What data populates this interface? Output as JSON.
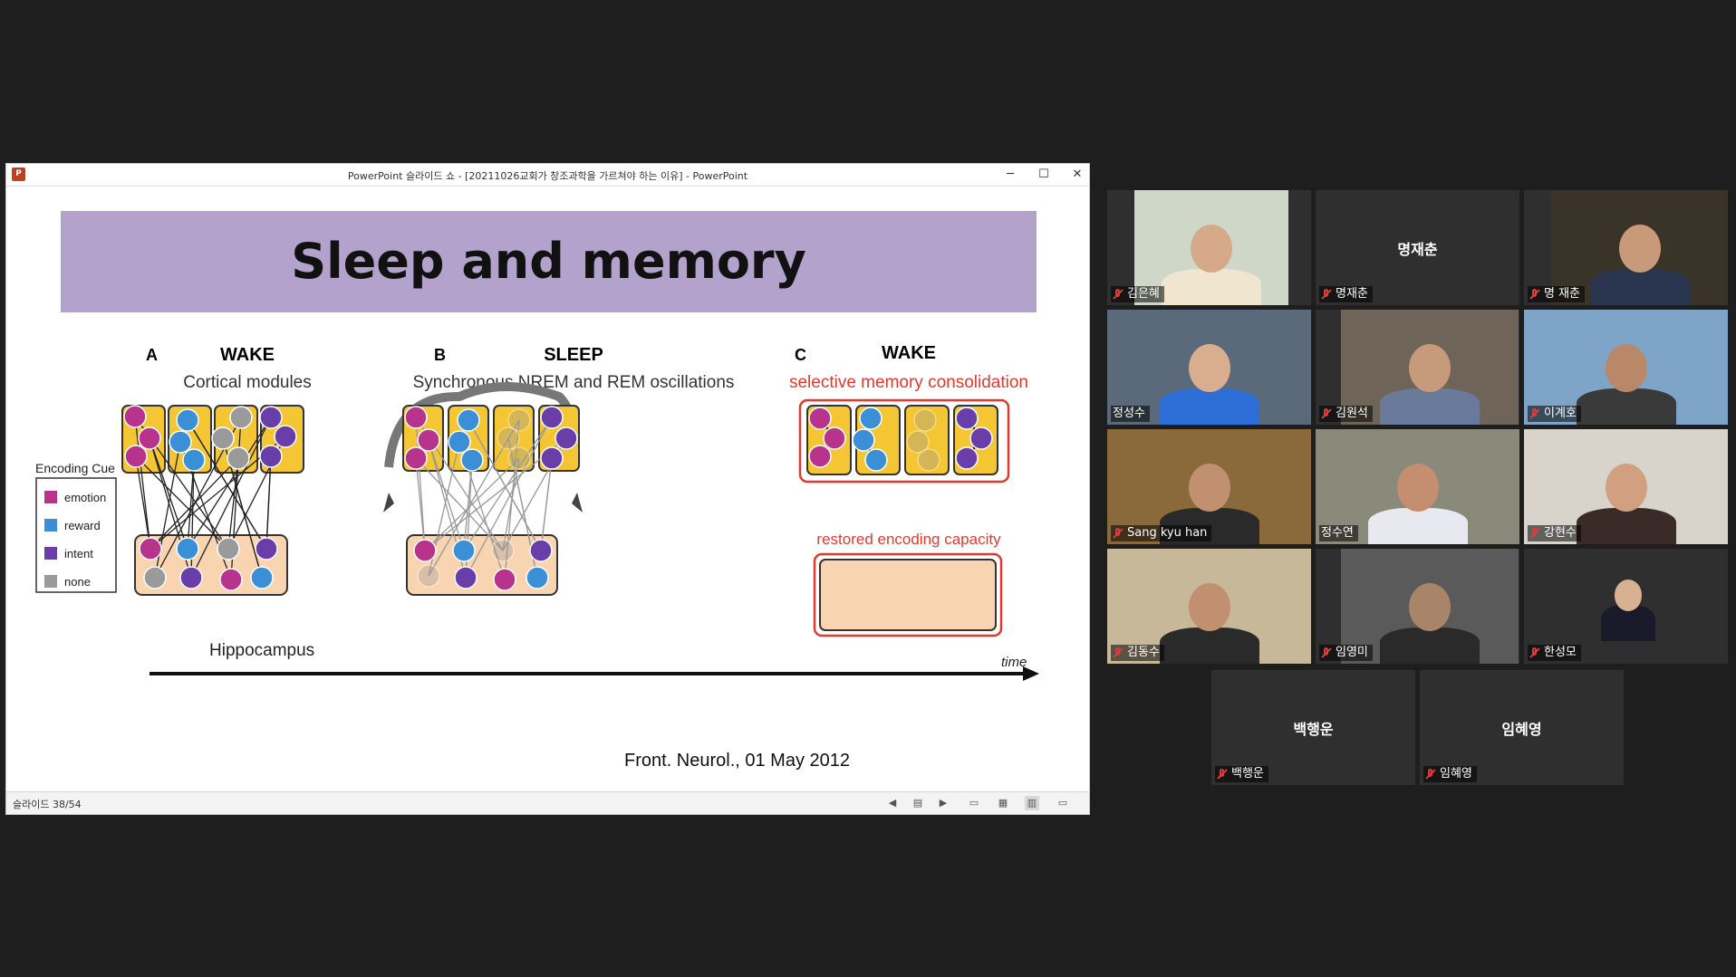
{
  "window": {
    "title": "PowerPoint 슬라이드 쇼 - [20211026교회가 창조과학을 가르쳐야 하는 이유] - PowerPoint",
    "minimize": "─",
    "maximize": "☐",
    "close": "✕"
  },
  "slide": {
    "title": "Sleep and memory",
    "citation": "Front. Neurol., 01 May 2012",
    "figure": {
      "panels": [
        {
          "letter": "A",
          "state": "WAKE",
          "subtitle": "Cortical modules"
        },
        {
          "letter": "B",
          "state": "SLEEP",
          "subtitle": "Synchronous NREM and REM oscillations"
        },
        {
          "letter": "C",
          "state": "WAKE",
          "subtitle": "selective memory consolidation"
        }
      ],
      "restored_label": "restored encoding capacity",
      "hippocampus_label": "Hippocampus",
      "time_label": "time",
      "legend": {
        "title": "Encoding Cue",
        "items": [
          {
            "label": "emotion",
            "color": "#b8338c"
          },
          {
            "label": "reward",
            "color": "#3a8fd6"
          },
          {
            "label": "intent",
            "color": "#6a3ea8"
          },
          {
            "label": "none",
            "color": "#9a9a9a"
          }
        ]
      },
      "colors": {
        "module": "#f5c633",
        "hippocampus": "#f9d4b0",
        "red": "#e03a2f"
      }
    }
  },
  "statusbar": {
    "slide_counter": "슬라이드 38/54"
  },
  "participants": [
    {
      "name": "김은혜",
      "video": true
    },
    {
      "name": "명재춘",
      "video": false
    },
    {
      "name": "명 재춘",
      "video": true
    },
    {
      "name": "정성수",
      "video": true,
      "active": true
    },
    {
      "name": "김원석",
      "video": true
    },
    {
      "name": "이계호",
      "video": true
    },
    {
      "name": "Sang kyu han",
      "video": true
    },
    {
      "name": "정수연",
      "video": true
    },
    {
      "name": "강현수",
      "video": true
    },
    {
      "name": "김동수",
      "video": true
    },
    {
      "name": "임영미",
      "video": true
    },
    {
      "name": "한성모",
      "video": true
    },
    {
      "name": "백행운",
      "video": false
    },
    {
      "name": "임혜영",
      "video": false
    }
  ]
}
